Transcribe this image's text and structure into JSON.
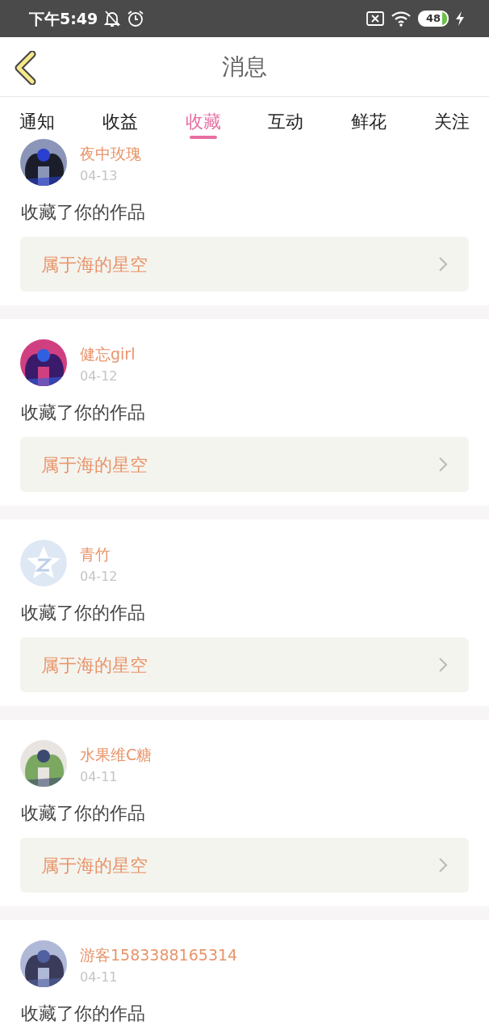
{
  "status_bar": {
    "time": "下午5:49",
    "battery": "48"
  },
  "header": {
    "title": "消息"
  },
  "tabs": [
    {
      "label": "通知",
      "selected": false
    },
    {
      "label": "收益",
      "selected": false
    },
    {
      "label": "收藏",
      "selected": true
    },
    {
      "label": "互动",
      "selected": false
    },
    {
      "label": "鲜花",
      "selected": false
    },
    {
      "label": "关注",
      "selected": false
    }
  ],
  "messages": [
    {
      "name": "夜中玫瑰",
      "date": "04-13",
      "action": "收藏了你的作品",
      "work": "属于海的星空"
    },
    {
      "name": "健忘girl",
      "date": "04-12",
      "action": "收藏了你的作品",
      "work": "属于海的星空"
    },
    {
      "avatar": {
        "kind": "default"
      },
      "name": "青竹",
      "date": "04-12",
      "action": "收藏了你的作品",
      "work": "属于海的星空"
    },
    {
      "name": "水果维C糖",
      "date": "04-11",
      "action": "收藏了你的作品",
      "work": "属于海的星空"
    },
    {
      "name": "游客1583388165314",
      "date": "04-11",
      "action": "收藏了你的作品"
    }
  ]
}
